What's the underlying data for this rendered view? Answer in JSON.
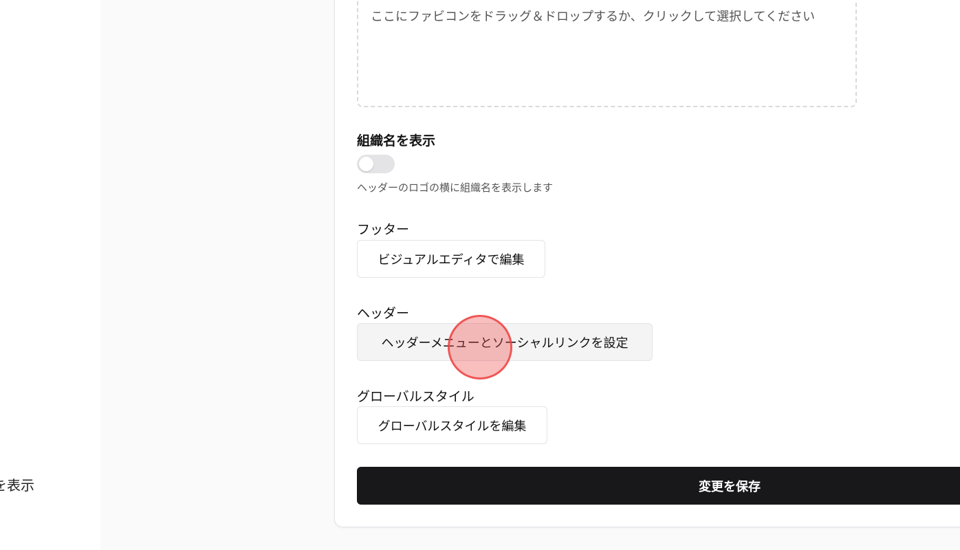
{
  "sidebar": {
    "partial_item_label": "を表示"
  },
  "favicon": {
    "dropzone_text": "ここにファビコンをドラッグ＆ドロップするか、クリックして選択してください"
  },
  "org_name": {
    "label": "組織名を表示",
    "toggle_on": false,
    "hint": "ヘッダーのロゴの横に組織名を表示します"
  },
  "footer": {
    "label": "フッター",
    "button_label": "ビジュアルエディタで編集"
  },
  "header": {
    "label": "ヘッダー",
    "button_label": "ヘッダーメニューとソーシャルリンクを設定"
  },
  "global_style": {
    "label": "グローバルスタイル",
    "button_label": "グローバルスタイルを編集"
  },
  "actions": {
    "save_label": "変更を保存"
  },
  "colors": {
    "primary": "#18181b",
    "toggle_off": "#e4e4e7",
    "click_indicator": "#ef4444"
  }
}
